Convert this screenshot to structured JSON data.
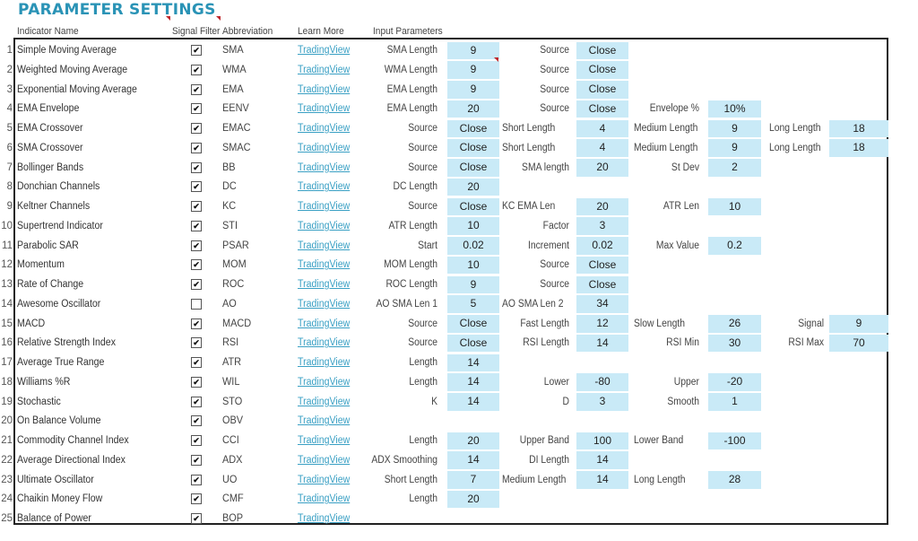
{
  "title": "PARAMETER SETTINGS",
  "headers": {
    "indicator_name": "Indicator Name",
    "signal_filter": "Signal Filter",
    "abbreviation": "Abbreviation",
    "learn_more": "Learn More",
    "input_parameters": "Input Parameters"
  },
  "colors": {
    "title": "#2a93b6",
    "input_cell": "#c9eaf7",
    "link": "#3aa0c4",
    "comment_marker": "#c0282d"
  },
  "rows": [
    {
      "num": "1",
      "name": "Simple Moving Average",
      "checked": true,
      "abbr": "SMA",
      "link": "TradingView",
      "params": [
        {
          "label": "SMA Length",
          "value": "9"
        },
        {
          "label": "Source",
          "value": "Close"
        }
      ]
    },
    {
      "num": "2",
      "name": "Weighted Moving Average",
      "checked": true,
      "abbr": "WMA",
      "link": "TradingView",
      "params": [
        {
          "label": "WMA Length",
          "value": "9"
        },
        {
          "label": "Source",
          "value": "Close"
        }
      ]
    },
    {
      "num": "3",
      "name": "Exponential Moving Average",
      "checked": true,
      "abbr": "EMA",
      "link": "TradingView",
      "params": [
        {
          "label": "EMA Length",
          "value": "9"
        },
        {
          "label": "Source",
          "value": "Close"
        }
      ]
    },
    {
      "num": "4",
      "name": "EMA Envelope",
      "checked": true,
      "abbr": "EENV",
      "link": "TradingView",
      "params": [
        {
          "label": "EMA Length",
          "value": "20"
        },
        {
          "label": "Source",
          "value": "Close"
        },
        {
          "label": "Envelope %",
          "value": "10%"
        }
      ]
    },
    {
      "num": "5",
      "name": "EMA Crossover",
      "checked": true,
      "abbr": "EMAC",
      "link": "TradingView",
      "params": [
        {
          "label": "Source",
          "value": "Close"
        },
        {
          "label": "Short Length",
          "value": "4",
          "align": "left"
        },
        {
          "label": "Medium Length",
          "value": "9",
          "align": "left"
        },
        {
          "label": "Long Length",
          "value": "18",
          "align": "left"
        }
      ]
    },
    {
      "num": "6",
      "name": "SMA Crossover",
      "checked": true,
      "abbr": "SMAC",
      "link": "TradingView",
      "params": [
        {
          "label": "Source",
          "value": "Close"
        },
        {
          "label": "Short Length",
          "value": "4",
          "align": "left"
        },
        {
          "label": "Medium Length",
          "value": "9",
          "align": "left"
        },
        {
          "label": "Long Length",
          "value": "18",
          "align": "left"
        }
      ]
    },
    {
      "num": "7",
      "name": "Bollinger Bands",
      "checked": true,
      "abbr": "BB",
      "link": "TradingView",
      "params": [
        {
          "label": "Source",
          "value": "Close"
        },
        {
          "label": "SMA length",
          "value": "20"
        },
        {
          "label": "St Dev",
          "value": "2"
        }
      ]
    },
    {
      "num": "8",
      "name": "Donchian Channels",
      "checked": true,
      "abbr": "DC",
      "link": "TradingView",
      "params": [
        {
          "label": "DC Length",
          "value": "20"
        }
      ]
    },
    {
      "num": "9",
      "name": "Keltner Channels",
      "checked": true,
      "abbr": "KC",
      "link": "TradingView",
      "params": [
        {
          "label": "Source",
          "value": "Close"
        },
        {
          "label": "KC EMA Len",
          "value": "20",
          "align": "left"
        },
        {
          "label": "ATR Len",
          "value": "10"
        }
      ]
    },
    {
      "num": "10",
      "name": "Supertrend Indicator",
      "checked": true,
      "abbr": "STI",
      "link": "TradingView",
      "params": [
        {
          "label": "ATR Length",
          "value": "10"
        },
        {
          "label": "Factor",
          "value": "3"
        }
      ]
    },
    {
      "num": "11",
      "name": "Parabolic SAR",
      "checked": true,
      "abbr": "PSAR",
      "link": "TradingView",
      "params": [
        {
          "label": "Start",
          "value": "0.02"
        },
        {
          "label": "Increment",
          "value": "0.02"
        },
        {
          "label": "Max Value",
          "value": "0.2"
        }
      ]
    },
    {
      "num": "12",
      "name": "Momentum",
      "checked": true,
      "abbr": "MOM",
      "link": "TradingView",
      "params": [
        {
          "label": "MOM Length",
          "value": "10"
        },
        {
          "label": "Source",
          "value": "Close"
        }
      ]
    },
    {
      "num": "13",
      "name": "Rate of Change",
      "checked": true,
      "abbr": "ROC",
      "link": "TradingView",
      "params": [
        {
          "label": "ROC Length",
          "value": "9"
        },
        {
          "label": "Source",
          "value": "Close"
        }
      ]
    },
    {
      "num": "14",
      "name": "Awesome Oscillator",
      "checked": false,
      "abbr": "AO",
      "link": "TradingView",
      "params": [
        {
          "label": "AO SMA Len 1",
          "value": "5"
        },
        {
          "label": "AO SMA Len 2",
          "value": "34",
          "align": "left"
        }
      ]
    },
    {
      "num": "15",
      "name": "MACD",
      "checked": true,
      "abbr": "MACD",
      "link": "TradingView",
      "params": [
        {
          "label": "Source",
          "value": "Close"
        },
        {
          "label": "Fast Length",
          "value": "12"
        },
        {
          "label": "Slow Length",
          "value": "26",
          "align": "left"
        },
        {
          "label": "Signal",
          "value": "9"
        }
      ]
    },
    {
      "num": "16",
      "name": "Relative Strength Index",
      "checked": true,
      "abbr": "RSI",
      "link": "TradingView",
      "params": [
        {
          "label": "Source",
          "value": "Close"
        },
        {
          "label": "RSI Length",
          "value": "14"
        },
        {
          "label": "RSI Min",
          "value": "30"
        },
        {
          "label": "RSI Max",
          "value": "70"
        }
      ]
    },
    {
      "num": "17",
      "name": "Average True Range",
      "checked": true,
      "abbr": "ATR",
      "link": "TradingView",
      "params": [
        {
          "label": "Length",
          "value": "14"
        }
      ]
    },
    {
      "num": "18",
      "name": "Williams %R",
      "checked": true,
      "abbr": "WIL",
      "link": "TradingView",
      "params": [
        {
          "label": "Length",
          "value": "14"
        },
        {
          "label": "Lower",
          "value": "-80"
        },
        {
          "label": "Upper",
          "value": "-20"
        }
      ]
    },
    {
      "num": "19",
      "name": "Stochastic",
      "checked": true,
      "abbr": "STO",
      "link": "TradingView",
      "params": [
        {
          "label": "K",
          "value": "14"
        },
        {
          "label": "D",
          "value": "3"
        },
        {
          "label": "Smooth",
          "value": "1"
        }
      ]
    },
    {
      "num": "20",
      "name": "On Balance Volume",
      "checked": true,
      "abbr": "OBV",
      "link": "TradingView",
      "params": []
    },
    {
      "num": "21",
      "name": "Commodity Channel Index",
      "checked": true,
      "abbr": "CCI",
      "link": "TradingView",
      "params": [
        {
          "label": "Length",
          "value": "20"
        },
        {
          "label": "Upper Band",
          "value": "100"
        },
        {
          "label": "Lower Band",
          "value": "-100",
          "align": "left"
        }
      ]
    },
    {
      "num": "22",
      "name": "Average Directional Index",
      "checked": true,
      "abbr": "ADX",
      "link": "TradingView",
      "params": [
        {
          "label": "ADX Smoothing",
          "value": "14"
        },
        {
          "label": "DI Length",
          "value": "14"
        }
      ]
    },
    {
      "num": "23",
      "name": "Ultimate Oscillator",
      "checked": true,
      "abbr": "UO",
      "link": "TradingView",
      "params": [
        {
          "label": "Short Length",
          "value": "7"
        },
        {
          "label": "Medium Length",
          "value": "14",
          "align": "left"
        },
        {
          "label": "Long Length",
          "value": "28",
          "align": "left"
        }
      ]
    },
    {
      "num": "24",
      "name": "Chaikin Money Flow",
      "checked": true,
      "abbr": "CMF",
      "link": "TradingView",
      "params": [
        {
          "label": "Length",
          "value": "20"
        }
      ]
    },
    {
      "num": "25",
      "name": "Balance of Power",
      "checked": true,
      "abbr": "BOP",
      "link": "TradingView",
      "params": []
    }
  ]
}
